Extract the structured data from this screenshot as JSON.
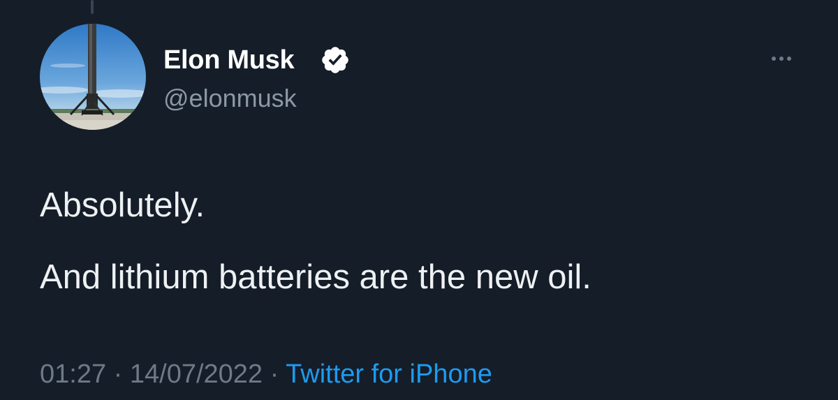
{
  "tweet": {
    "author": {
      "display_name": "Elon Musk",
      "handle": "@elonmusk",
      "verified_icon": "verified-badge-icon"
    },
    "text_lines": [
      "Absolutely.",
      "And lithium batteries are the new oil."
    ],
    "time": "01:27",
    "date": "14/07/2022",
    "separator": "·",
    "source": "Twitter for iPhone",
    "more_icon": "more-options-icon"
  },
  "colors": {
    "background": "#151d28",
    "primary_text": "#e7e9ea",
    "secondary_text": "#8b98a5",
    "link": "#1d9bf0"
  }
}
